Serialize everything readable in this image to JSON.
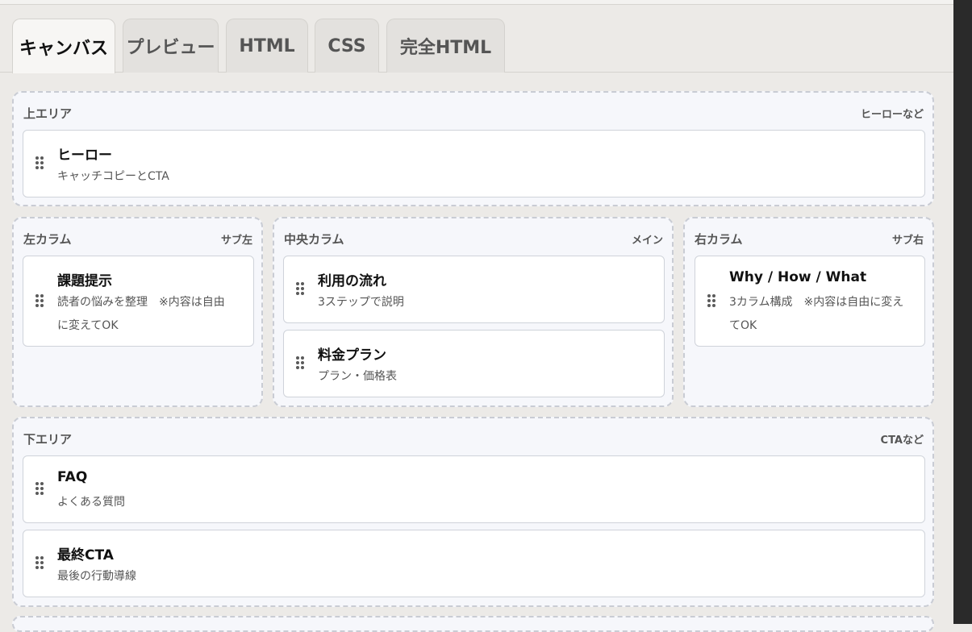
{
  "tabs": [
    {
      "label": "キャンバス",
      "active": true
    },
    {
      "label": "プレビュー",
      "active": false
    },
    {
      "label": "HTML",
      "active": false
    },
    {
      "label": "CSS",
      "active": false
    },
    {
      "label": "完全HTML",
      "active": false
    }
  ],
  "areas": {
    "top": {
      "label": "上エリア",
      "hint": "ヒーローなど",
      "cards": [
        {
          "title": "ヒーロー",
          "desc": "キャッチコピーとCTA"
        }
      ]
    },
    "left": {
      "label": "左カラム",
      "hint": "サブ左",
      "cards": [
        {
          "title": "課題提示",
          "desc_line1": "読者の悩みを整理　※内容は自由",
          "desc_line2": "に変えてOK"
        }
      ]
    },
    "center": {
      "label": "中央カラム",
      "hint": "メイン",
      "cards": [
        {
          "title": "利用の流れ",
          "desc": "3ステップで説明"
        },
        {
          "title": "料金プラン",
          "desc": "プラン・価格表"
        }
      ]
    },
    "right": {
      "label": "右カラム",
      "hint": "サブ右",
      "cards": [
        {
          "title": "Why / How / What",
          "desc_line1": "3カラム構成　※内容は自由に変え",
          "desc_line2": "てOK"
        }
      ]
    },
    "bottom": {
      "label": "下エリア",
      "hint": "CTAなど",
      "cards": [
        {
          "title": "FAQ",
          "desc": "よくある質問"
        },
        {
          "title": "最終CTA",
          "desc": "最後の行動導線"
        }
      ]
    }
  }
}
